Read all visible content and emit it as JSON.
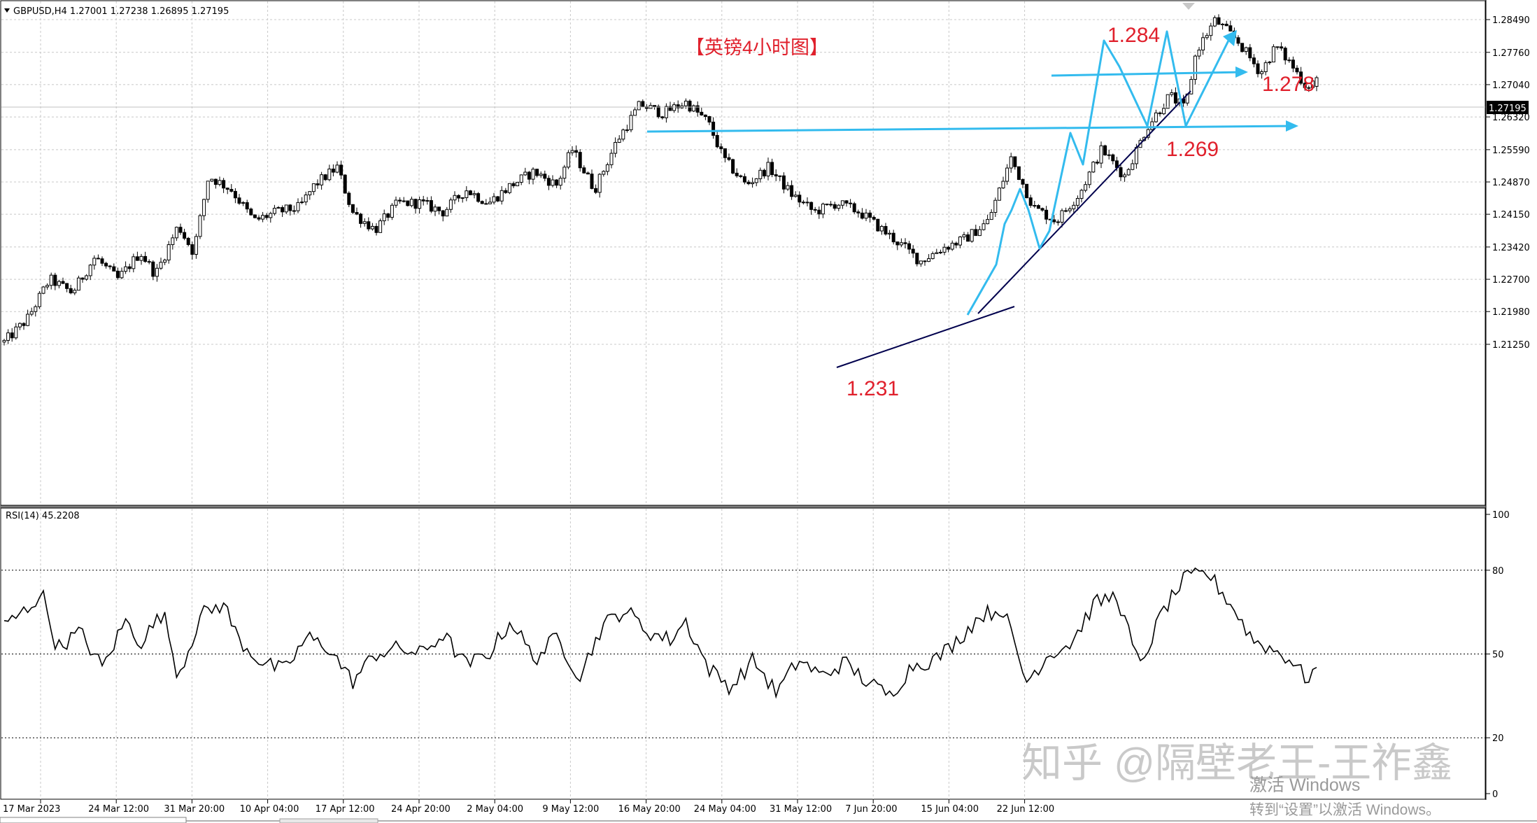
{
  "header": {
    "symbol_info": "GBPUSD,H4  1.27001 1.27238 1.26895 1.27195",
    "annotation_title": "【英镑4小时图】"
  },
  "price_axis": {
    "ticks": [
      "1.28490",
      "1.27760",
      "1.27040",
      "1.26320",
      "1.25590",
      "1.24870",
      "1.24150",
      "1.23420",
      "1.22700",
      "1.21980",
      "1.21250"
    ],
    "current_price": "1.27195"
  },
  "rsi_panel": {
    "label": "RSI(14) 45.2208",
    "ticks": [
      "100",
      "80",
      "50",
      "20",
      "0"
    ]
  },
  "time_axis": {
    "labels": [
      "17 Mar 2023",
      "24 Mar 12:00",
      "31 Mar 20:00",
      "10 Apr 04:00",
      "17 Apr 12:00",
      "24 Apr 20:00",
      "2 May 04:00",
      "9 May 12:00",
      "16 May 20:00",
      "24 May 04:00",
      "31 May 12:00",
      "7 Jun 20:00",
      "15 Jun 04:00",
      "22 Jun 12:00"
    ]
  },
  "annotations": {
    "level_1284": "1.284",
    "level_1278": "1.278",
    "level_1269": "1.269",
    "level_1231": "1.231"
  },
  "watermark": {
    "zhihu": "知乎 @隔壁老王-王祚鑫",
    "activate_line1": "激活 Windows",
    "activate_line2": "转到“设置”以激活 Windows。"
  },
  "colors": {
    "candle": "#000000",
    "annotation_red": "#e0202c",
    "arrow_blue": "#33bbee",
    "trendline_navy": "#00004d",
    "grid": "#c8c8c8"
  },
  "chart_data": [
    {
      "type": "candlestick",
      "title": "",
      "symbol": "GBPUSD",
      "timeframe": "H4",
      "last_bar": {
        "open": 1.27001,
        "high": 1.27238,
        "low": 1.26895,
        "close": 1.27195
      },
      "ylim": [
        1.2085,
        1.2885
      ],
      "x": [
        "17 Mar 2023",
        "24 Mar 12:00",
        "31 Mar 20:00",
        "10 Apr 04:00",
        "17 Apr 12:00",
        "24 Apr 20:00",
        "2 May 04:00",
        "9 May 12:00",
        "16 May 20:00",
        "24 May 04:00",
        "31 May 12:00",
        "7 Jun 20:00",
        "15 Jun 04:00",
        "22 Jun 12:00"
      ],
      "close_path": [
        [
          0,
          1.213
        ],
        [
          0.3,
          1.218
        ],
        [
          0.6,
          1.227
        ],
        [
          0.9,
          1.224
        ],
        [
          1.2,
          1.232
        ],
        [
          1.5,
          1.227
        ],
        [
          1.8,
          1.233
        ],
        [
          2.0,
          1.228
        ],
        [
          2.3,
          1.239
        ],
        [
          2.5,
          1.233
        ],
        [
          2.7,
          1.25
        ],
        [
          3.0,
          1.247
        ],
        [
          3.3,
          1.24
        ],
        [
          3.6,
          1.242
        ],
        [
          3.9,
          1.243
        ],
        [
          4.1,
          1.248
        ],
        [
          4.4,
          1.252
        ],
        [
          4.6,
          1.242
        ],
        [
          4.9,
          1.238
        ],
        [
          5.2,
          1.244
        ],
        [
          5.5,
          1.244
        ],
        [
          5.8,
          1.242
        ],
        [
          6.1,
          1.247
        ],
        [
          6.4,
          1.244
        ],
        [
          6.7,
          1.248
        ],
        [
          7.0,
          1.251
        ],
        [
          7.3,
          1.248
        ],
        [
          7.5,
          1.256
        ],
        [
          7.8,
          1.247
        ],
        [
          8.1,
          1.258
        ],
        [
          8.4,
          1.266
        ],
        [
          8.7,
          1.264
        ],
        [
          9.0,
          1.2665
        ],
        [
          9.3,
          1.262
        ],
        [
          9.5,
          1.254
        ],
        [
          9.8,
          1.248
        ],
        [
          10.1,
          1.252
        ],
        [
          10.4,
          1.246
        ],
        [
          10.7,
          1.242
        ],
        [
          11.0,
          1.244
        ],
        [
          11.3,
          1.242
        ],
        [
          11.6,
          1.238
        ],
        [
          11.9,
          1.234
        ],
        [
          12.1,
          1.231
        ],
        [
          12.4,
          1.234
        ],
        [
          12.7,
          1.236
        ],
        [
          13.0,
          1.24
        ],
        [
          13.3,
          1.254
        ],
        [
          13.6,
          1.243
        ],
        [
          13.9,
          1.24
        ],
        [
          14.2,
          1.246
        ],
        [
          14.5,
          1.256
        ],
        [
          14.8,
          1.25
        ],
        [
          15.1,
          1.261
        ],
        [
          15.4,
          1.268
        ],
        [
          15.6,
          1.265
        ],
        [
          15.75,
          1.278
        ],
        [
          16.0,
          1.2848
        ],
        [
          16.3,
          1.28
        ],
        [
          16.6,
          1.273
        ],
        [
          16.8,
          1.279
        ],
        [
          17.0,
          1.275
        ],
        [
          17.2,
          1.27
        ],
        [
          17.35,
          1.2719
        ]
      ],
      "price_levels": [
        1.284,
        1.278,
        1.269,
        1.231
      ]
    },
    {
      "type": "line",
      "title": "RSI(14) 45.2208",
      "ylim": [
        0,
        100
      ],
      "levels": [
        20,
        50,
        80
      ],
      "x": [
        "17 Mar 2023",
        "24 Mar 12:00",
        "31 Mar 20:00",
        "10 Apr 04:00",
        "17 Apr 12:00",
        "24 Apr 20:00",
        "2 May 04:00",
        "9 May 12:00",
        "16 May 20:00",
        "24 May 04:00",
        "31 May 12:00",
        "7 Jun 20:00",
        "15 Jun 04:00",
        "22 Jun 12:00"
      ],
      "values_path": [
        [
          0,
          60
        ],
        [
          0.3,
          66
        ],
        [
          0.5,
          72
        ],
        [
          0.7,
          52
        ],
        [
          1.0,
          58
        ],
        [
          1.3,
          45
        ],
        [
          1.6,
          62
        ],
        [
          1.8,
          54
        ],
        [
          2.1,
          65
        ],
        [
          2.3,
          42
        ],
        [
          2.6,
          64
        ],
        [
          2.9,
          68
        ],
        [
          3.1,
          55
        ],
        [
          3.4,
          47
        ],
        [
          3.7,
          44
        ],
        [
          4.0,
          56
        ],
        [
          4.3,
          52
        ],
        [
          4.6,
          40
        ],
        [
          4.9,
          50
        ],
        [
          5.2,
          52
        ],
        [
          5.5,
          50
        ],
        [
          5.8,
          57
        ],
        [
          6.1,
          46
        ],
        [
          6.4,
          50
        ],
        [
          6.7,
          62
        ],
        [
          7.0,
          48
        ],
        [
          7.3,
          56
        ],
        [
          7.6,
          42
        ],
        [
          7.9,
          60
        ],
        [
          8.2,
          66
        ],
        [
          8.5,
          58
        ],
        [
          8.8,
          55
        ],
        [
          9.0,
          62
        ],
        [
          9.3,
          45
        ],
        [
          9.6,
          38
        ],
        [
          9.9,
          48
        ],
        [
          10.2,
          36
        ],
        [
          10.5,
          48
        ],
        [
          10.8,
          42
        ],
        [
          11.1,
          47
        ],
        [
          11.4,
          40
        ],
        [
          11.7,
          35
        ],
        [
          12.0,
          46
        ],
        [
          12.3,
          48
        ],
        [
          12.6,
          55
        ],
        [
          12.9,
          64
        ],
        [
          13.2,
          66
        ],
        [
          13.5,
          40
        ],
        [
          13.8,
          50
        ],
        [
          14.1,
          54
        ],
        [
          14.4,
          68
        ],
        [
          14.7,
          71
        ],
        [
          15.0,
          45
        ],
        [
          15.3,
          65
        ],
        [
          15.6,
          77
        ],
        [
          15.9,
          79
        ],
        [
          16.2,
          68
        ],
        [
          16.5,
          55
        ],
        [
          16.8,
          51
        ],
        [
          17.0,
          48
        ],
        [
          17.2,
          41
        ],
        [
          17.35,
          45.2
        ]
      ]
    }
  ]
}
